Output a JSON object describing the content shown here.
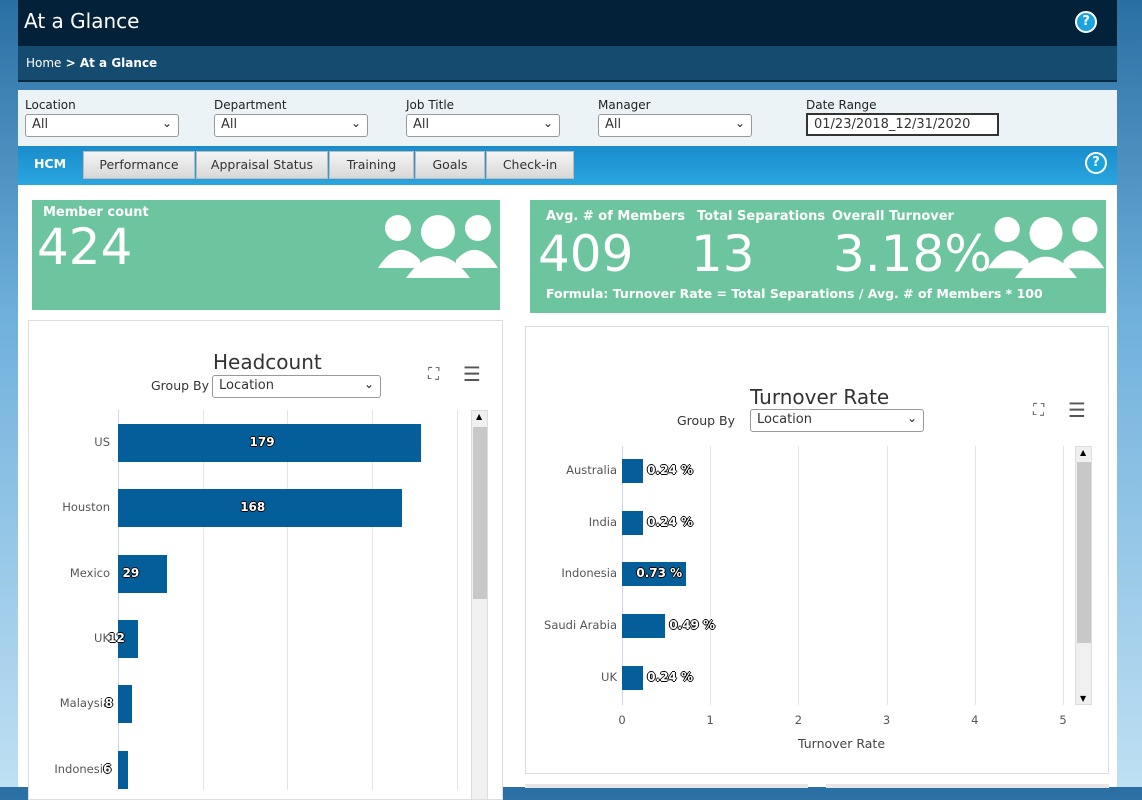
{
  "header": {
    "title": "At a Glance",
    "help_icon": "?"
  },
  "breadcrumb": {
    "home": "Home",
    "separator": " > ",
    "current": "At a Glance"
  },
  "filters": [
    {
      "label": "Location",
      "value": "All"
    },
    {
      "label": "Department",
      "value": "All"
    },
    {
      "label": "Job Title",
      "value": "All"
    },
    {
      "label": "Manager",
      "value": "All"
    }
  ],
  "date_range": {
    "label": "Date Range",
    "value": "01/23/2018_12/31/2020"
  },
  "tabs": [
    "HCM",
    "Performance",
    "Appraisal Status",
    "Training",
    "Goals",
    "Check-in"
  ],
  "member_card": {
    "label": "Member count",
    "value": "424"
  },
  "turnover_card": {
    "avg_label": "Avg. # of Members",
    "avg_value": "409",
    "sep_label": "Total Separations",
    "sep_value": "13",
    "turn_label": "Overall Turnover",
    "turn_value": "3.18%",
    "formula": "Formula: Turnover Rate = Total Separations / Avg. # of Members * 100"
  },
  "colors": {
    "bar": "#035e99",
    "card": "#6cc59e"
  },
  "chart_data": [
    {
      "type": "bar",
      "orientation": "horizontal",
      "title": "Headcount",
      "group_by_label": "Group By",
      "group_by": "Location",
      "categories": [
        "US",
        "Houston",
        "Mexico",
        "UK",
        "Malaysia",
        "Indonesia"
      ],
      "values": [
        179,
        168,
        29,
        12,
        8,
        6
      ],
      "value_labels": [
        "179",
        "168",
        "29",
        "12",
        "8",
        "6"
      ],
      "xlim": [
        0,
        200
      ],
      "grid": true
    },
    {
      "type": "bar",
      "orientation": "horizontal",
      "title": "Turnover Rate",
      "group_by_label": "Group By",
      "group_by": "Location",
      "categories": [
        "Australia",
        "India",
        "Indonesia",
        "Saudi Arabia",
        "UK"
      ],
      "values": [
        0.24,
        0.24,
        0.73,
        0.49,
        0.24
      ],
      "value_labels": [
        "0.24 %",
        "0.24 %",
        "0.73 %",
        "0.49 %",
        "0.24 %"
      ],
      "xlim": [
        0,
        5
      ],
      "xticks": [
        "0",
        "1",
        "2",
        "3",
        "4",
        "5"
      ],
      "xlabel": "Turnover Rate",
      "grid": true
    }
  ]
}
